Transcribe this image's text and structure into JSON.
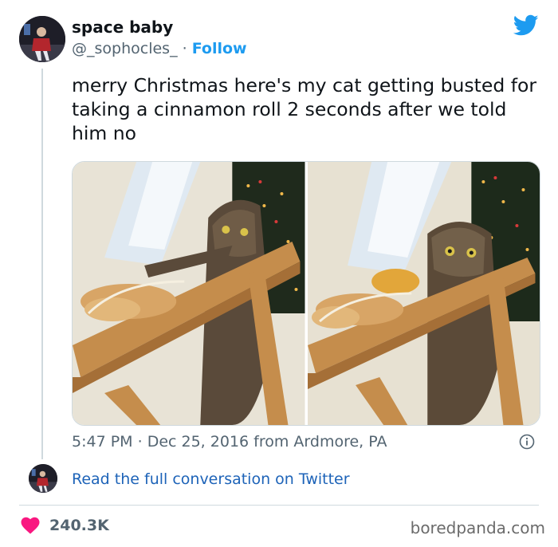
{
  "user": {
    "name": "space baby",
    "handle": "@_sophocles_",
    "separator": "·",
    "follow_label": "Follow"
  },
  "tweet": {
    "text": "merry Christmas here's my cat getting busted for taking a cinnamon roll 2 seconds after we told him no",
    "time": "5:47 PM",
    "meta_separator": "·",
    "date": "Dec 25, 2016",
    "location": "from Ardmore, PA"
  },
  "media": {
    "photo_count": 2
  },
  "footer": {
    "read_link": "Read the full conversation on Twitter",
    "likes": "240.3K"
  },
  "watermark": "boredpanda.com",
  "icons": {
    "brand": "twitter-bird-icon",
    "info": "info-icon",
    "like": "heart-icon"
  },
  "colors": {
    "twitter_blue": "#1d9bf0",
    "link_blue": "#1d63b8",
    "heart_red": "#f91880",
    "secondary_text": "#536471"
  }
}
